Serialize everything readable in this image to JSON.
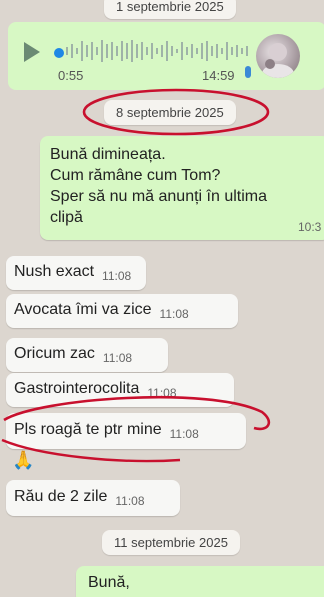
{
  "dates": {
    "top": "1 septembrie 2025",
    "middle": "8 septembrie 2025",
    "bottom": "11 septembrie 2025"
  },
  "voice_message": {
    "duration": "0:55",
    "time": "14:59"
  },
  "messages": [
    {
      "text_lines": [
        "Bună dimineața.",
        "Cum rămâne cum Tom?",
        "Sper să nu mă anunți în ultima",
        "clipă"
      ],
      "time": "10:3"
    },
    {
      "text": "Nush exact",
      "time": "11:08"
    },
    {
      "text": "Avocata îmi va zice",
      "time": "11:08"
    },
    {
      "text": "Oricum zac",
      "time": "11:08"
    },
    {
      "text": "Gastrointerocolita",
      "time": "11:08"
    },
    {
      "text": "Pls roagă te ptr mine",
      "time": "11:08"
    },
    {
      "text": "🙏"
    },
    {
      "text": "Rău de 2 zile",
      "time": "11:08"
    },
    {
      "text": "Bună,"
    }
  ],
  "colors": {
    "background": "#dcd6cf",
    "outgoing_bubble": "#d7f8c4",
    "incoming_bubble": "#f7f7f5",
    "annotation_red": "#c8102e",
    "voice_dot": "#1e88e5"
  },
  "icons": {
    "play": "play-icon",
    "mic": "mic-icon",
    "avatar": "avatar"
  }
}
